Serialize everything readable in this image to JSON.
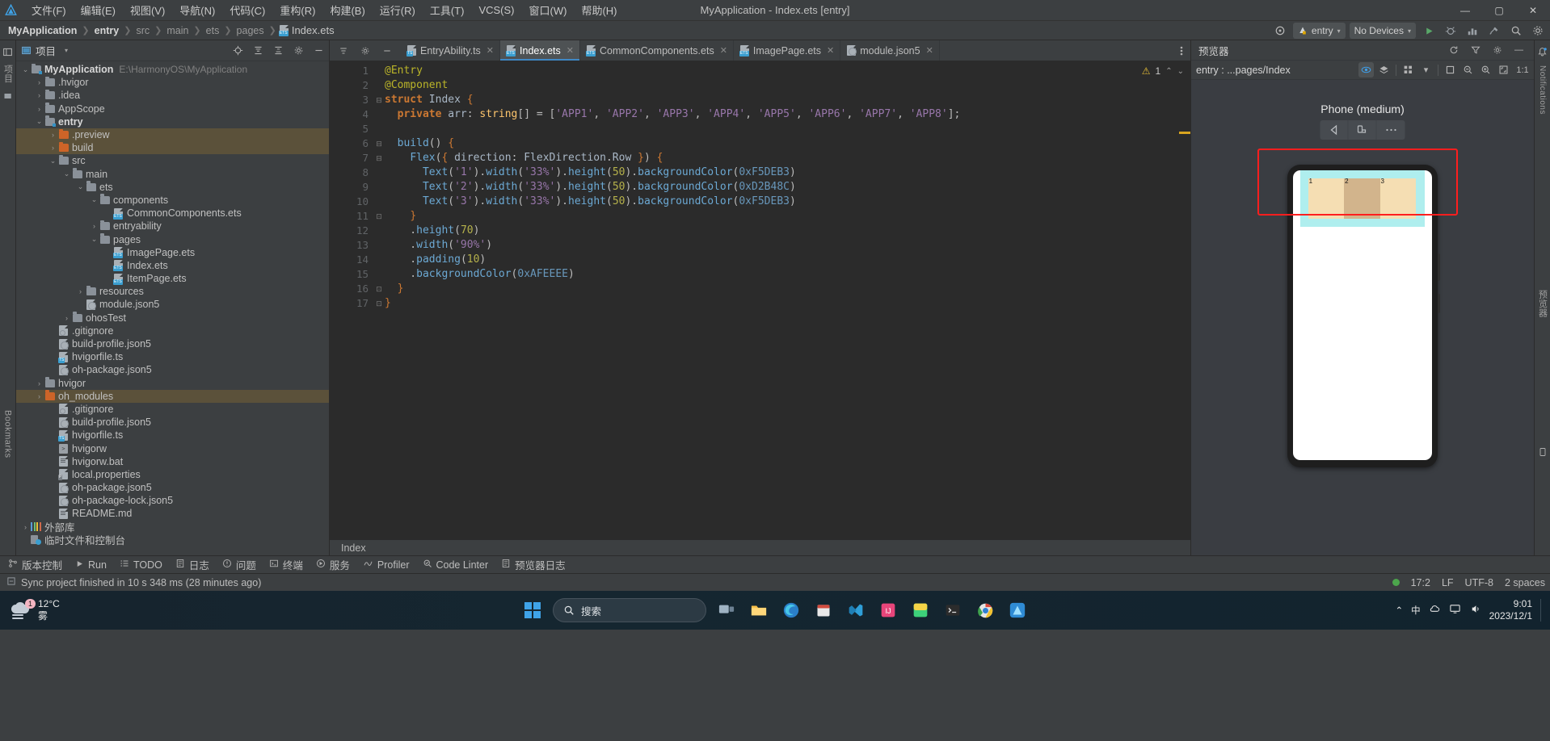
{
  "titlebar": {
    "menus": [
      "文件(F)",
      "编辑(E)",
      "视图(V)",
      "导航(N)",
      "代码(C)",
      "重构(R)",
      "构建(B)",
      "运行(R)",
      "工具(T)",
      "VCS(S)",
      "窗口(W)",
      "帮助(H)"
    ],
    "window_title": "MyApplication - Index.ets [entry]",
    "minimize": "—",
    "maximize": "▢",
    "close": "✕"
  },
  "breadcrumb": {
    "project": "MyApplication",
    "items": [
      "entry",
      "src",
      "main",
      "ets",
      "pages"
    ],
    "file": "Index.ets",
    "separator": "❯"
  },
  "toolbar": {
    "device_target": "entry",
    "devices": "No Devices",
    "caret": "▾"
  },
  "project_panel": {
    "title": "项目",
    "caret": "▾",
    "tree": [
      {
        "depth": 0,
        "arrow": "v",
        "icon": "folder-module",
        "label": "MyApplication",
        "bold": true,
        "path": "E:\\HarmonyOS\\MyApplication"
      },
      {
        "depth": 1,
        "arrow": ">",
        "icon": "folder",
        "label": ".hvigor"
      },
      {
        "depth": 1,
        "arrow": ">",
        "icon": "folder",
        "label": ".idea"
      },
      {
        "depth": 1,
        "arrow": ">",
        "icon": "folder",
        "label": "AppScope"
      },
      {
        "depth": 1,
        "arrow": "v",
        "icon": "folder-module",
        "label": "entry",
        "bold": true
      },
      {
        "depth": 2,
        "arrow": ">",
        "icon": "folder-orange",
        "label": ".preview",
        "highlight": true
      },
      {
        "depth": 2,
        "arrow": ">",
        "icon": "folder-orange",
        "label": "build",
        "highlight": true
      },
      {
        "depth": 2,
        "arrow": "v",
        "icon": "folder",
        "label": "src"
      },
      {
        "depth": 3,
        "arrow": "v",
        "icon": "folder",
        "label": "main"
      },
      {
        "depth": 4,
        "arrow": "v",
        "icon": "folder",
        "label": "ets"
      },
      {
        "depth": 5,
        "arrow": "v",
        "icon": "folder",
        "label": "components"
      },
      {
        "depth": 6,
        "arrow": "",
        "icon": "file-ets",
        "label": "CommonComponents.ets"
      },
      {
        "depth": 5,
        "arrow": ">",
        "icon": "folder",
        "label": "entryability"
      },
      {
        "depth": 5,
        "arrow": "v",
        "icon": "folder",
        "label": "pages"
      },
      {
        "depth": 6,
        "arrow": "",
        "icon": "file-ets",
        "label": "ImagePage.ets"
      },
      {
        "depth": 6,
        "arrow": "",
        "icon": "file-ets",
        "label": "Index.ets"
      },
      {
        "depth": 6,
        "arrow": "",
        "icon": "file-ets",
        "label": "ItemPage.ets"
      },
      {
        "depth": 4,
        "arrow": ">",
        "icon": "folder",
        "label": "resources"
      },
      {
        "depth": 4,
        "arrow": "",
        "icon": "file-json5",
        "label": "module.json5"
      },
      {
        "depth": 3,
        "arrow": ">",
        "icon": "folder",
        "label": "ohosTest"
      },
      {
        "depth": 2,
        "arrow": "",
        "icon": "file-gitignore",
        "label": ".gitignore"
      },
      {
        "depth": 2,
        "arrow": "",
        "icon": "file-json5",
        "label": "build-profile.json5"
      },
      {
        "depth": 2,
        "arrow": "",
        "icon": "file-ts",
        "label": "hvigorfile.ts"
      },
      {
        "depth": 2,
        "arrow": "",
        "icon": "file-json5",
        "label": "oh-package.json5"
      },
      {
        "depth": 1,
        "arrow": ">",
        "icon": "folder",
        "label": "hvigor"
      },
      {
        "depth": 1,
        "arrow": ">",
        "icon": "folder-orange",
        "label": "oh_modules",
        "highlight": true
      },
      {
        "depth": 2,
        "arrow": "",
        "icon": "file-gitignore",
        "label": ".gitignore"
      },
      {
        "depth": 2,
        "arrow": "",
        "icon": "file-json5",
        "label": "build-profile.json5"
      },
      {
        "depth": 2,
        "arrow": "",
        "icon": "file-ts",
        "label": "hvigorfile.ts"
      },
      {
        "depth": 2,
        "arrow": "",
        "icon": "file-sh",
        "label": "hvigorw"
      },
      {
        "depth": 2,
        "arrow": "",
        "icon": "file-bat",
        "label": "hvigorw.bat"
      },
      {
        "depth": 2,
        "arrow": "",
        "icon": "file-props",
        "label": "local.properties"
      },
      {
        "depth": 2,
        "arrow": "",
        "icon": "file-json5",
        "label": "oh-package.json5"
      },
      {
        "depth": 2,
        "arrow": "",
        "icon": "file-json5",
        "label": "oh-package-lock.json5"
      },
      {
        "depth": 2,
        "arrow": "",
        "icon": "file-md",
        "label": "README.md"
      },
      {
        "depth": 0,
        "arrow": ">",
        "icon": "library",
        "label": "外部库"
      },
      {
        "depth": 0,
        "arrow": "",
        "icon": "scratch",
        "label": "临时文件和控制台"
      }
    ]
  },
  "editor": {
    "tabs": [
      {
        "label": "EntryAbility.ts",
        "icon": "file-ts",
        "active": false
      },
      {
        "label": "Index.ets",
        "icon": "file-ets",
        "active": true
      },
      {
        "label": "CommonComponents.ets",
        "icon": "file-ets",
        "active": false
      },
      {
        "label": "ImagePage.ets",
        "icon": "file-ets",
        "active": false
      },
      {
        "label": "module.json5",
        "icon": "file-json5",
        "active": false
      }
    ],
    "warning_count": "1",
    "status_breadcrumb": "Index",
    "line_count": 17,
    "code_lines": [
      "@Entry",
      "@Component",
      "struct Index {",
      "  private arr: string[] = ['APP1', 'APP2', 'APP3', 'APP4', 'APP5', 'APP6', 'APP7', 'APP8'];",
      "",
      "  build() {",
      "    Flex({ direction: FlexDirection.Row }) {",
      "      Text('1').width('33%').height(50).backgroundColor(0xF5DEB3)",
      "      Text('2').width('33%').height(50).backgroundColor(0xD2B48C)",
      "      Text('3').width('33%').height(50).backgroundColor(0xF5DEB3)",
      "    }",
      "    .height(70)",
      "    .width('90%')",
      "    .padding(10)",
      "    .backgroundColor(0xAFEEEE)",
      "  }",
      "}"
    ]
  },
  "preview": {
    "title": "预览器",
    "route": "entry : ...pages/Index",
    "device_name": "Phone (medium)",
    "zoom_ratio": "1:1",
    "screen_cells": [
      {
        "label": "1",
        "color": "#F5DEB3"
      },
      {
        "label": "2",
        "color": "#D2B48C"
      },
      {
        "label": "3",
        "color": "#F5DEB3"
      }
    ],
    "container_color": "#AFEEEE"
  },
  "bottom_toolbar": [
    {
      "label": "版本控制",
      "icon": "branch-icon"
    },
    {
      "label": "Run",
      "icon": "play-icon"
    },
    {
      "label": "TODO",
      "icon": "list-icon"
    },
    {
      "label": "日志",
      "icon": "log-icon"
    },
    {
      "label": "问题",
      "icon": "warning-icon"
    },
    {
      "label": "终端",
      "icon": "terminal-icon"
    },
    {
      "label": "服务",
      "icon": "services-icon"
    },
    {
      "label": "Profiler",
      "icon": "profiler-icon"
    },
    {
      "label": "Code Linter",
      "icon": "linter-icon"
    },
    {
      "label": "预览器日志",
      "icon": "previewlog-icon"
    }
  ],
  "statusbar": {
    "message": "Sync project finished in 10 s 348 ms (28 minutes ago)",
    "cursor": "17:2",
    "line_sep": "LF",
    "encoding": "UTF-8",
    "indent": "2 spaces"
  },
  "rails": {
    "left_top": "项目",
    "left_bottom": "Bookmarks",
    "right_top": "Notifications",
    "right_bottom": "预览器"
  },
  "taskbar": {
    "weather_temp": "12°C",
    "weather_desc": "雾",
    "weather_badge": "1",
    "search_placeholder": "搜索",
    "clock_time": "9:01",
    "clock_date": "2023/12/1",
    "lang": "中"
  },
  "colors": {
    "accent": "#3f88c5",
    "warn": "#e8bf36",
    "highlight_row": "#5b513a",
    "redbox": "#ff1e1e"
  }
}
